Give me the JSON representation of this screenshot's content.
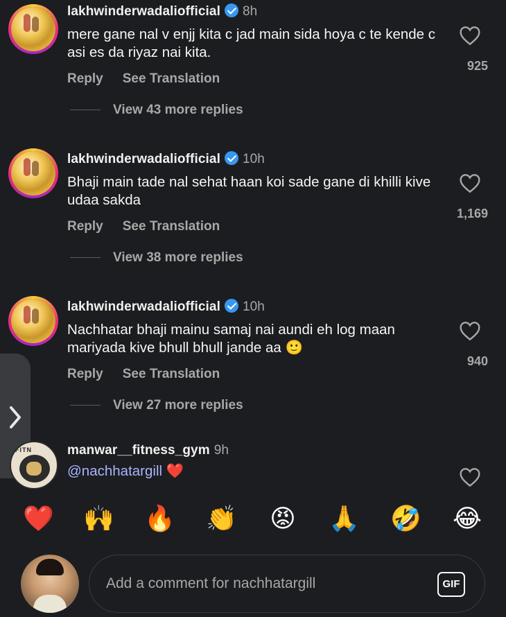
{
  "comments": [
    {
      "username": "lakhwinderwadaliofficial",
      "time": "8h",
      "text": "mere gane nal v enjj kita c jad main sida hoya c te kende c asi es da riyaz nai kita.",
      "likes": "925",
      "reply_label": "Reply",
      "translate_label": "See Translation",
      "more_replies": "View 43 more replies"
    },
    {
      "username": "lakhwinderwadaliofficial",
      "time": "10h",
      "text": "Bhaji main tade nal sehat haan koi sade gane di khilli kive udaa sakda",
      "likes": "1,169",
      "reply_label": "Reply",
      "translate_label": "See Translation",
      "more_replies": "View 38 more replies"
    },
    {
      "username": "lakhwinderwadaliofficial",
      "time": "10h",
      "text": "Nachhatar bhaji mainu samaj nai aundi eh log maan mariyada kive bhull bhull jande aa",
      "emoji": "🙂",
      "likes": "940",
      "reply_label": "Reply",
      "translate_label": "See Translation",
      "more_replies": "View 27 more replies"
    },
    {
      "username": "manwar__fitness_gym",
      "time": "9h",
      "mention": "@nachhatargill",
      "emoji": "❤️",
      "avatar_text": "FITN"
    }
  ],
  "emoji_bar": [
    "❤️",
    "🙌",
    "🔥",
    "👏",
    "😡",
    "🙏",
    "🤣",
    "😂"
  ],
  "composer": {
    "placeholder": "Add a comment for nachhatargill",
    "gif_label": "GIF"
  },
  "icons": {
    "heart": "heart-outline-icon",
    "verified": "verified-badge-icon",
    "side": "chevron-right-icon"
  },
  "colors": {
    "background": "#1c1d20",
    "muted": "#a8a8a8",
    "verified": "#3897f0",
    "mention": "#a9b4ff"
  }
}
